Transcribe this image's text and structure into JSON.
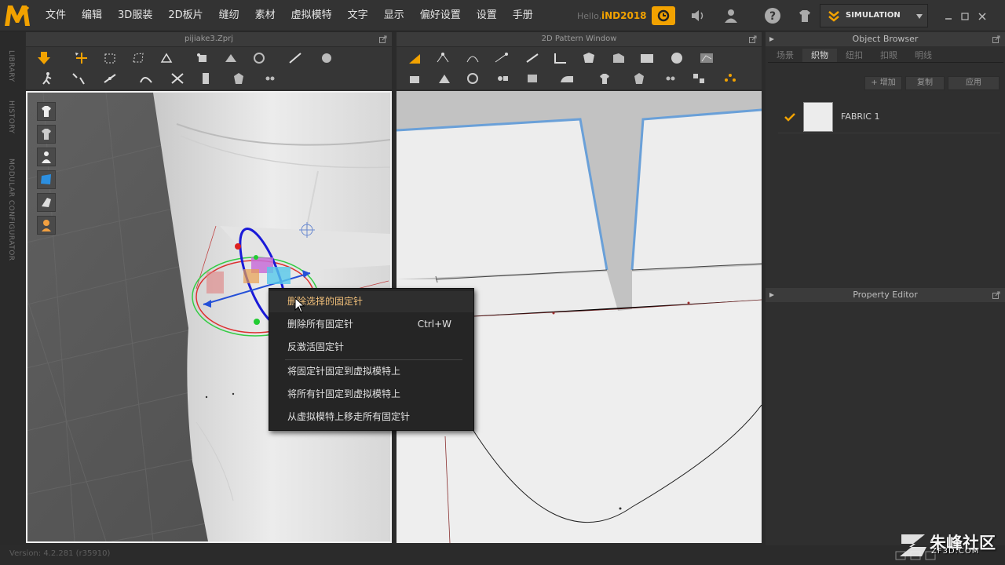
{
  "app": {
    "menu": [
      "文件",
      "编辑",
      "3D服装",
      "2D板片",
      "缝纫",
      "素材",
      "虚拟模特",
      "文字",
      "显示",
      "偏好设置",
      "设置",
      "手册"
    ],
    "hello": "Hello,",
    "user": "iND2018",
    "simulation_label": "SIMULATION",
    "accent": "#f2a200"
  },
  "sidebar_tabs": [
    "LIBRARY",
    "HISTORY",
    "MODULAR CONFIGURATOR"
  ],
  "panel_3d": {
    "title": "pijiake3.Zprj"
  },
  "panel_2d": {
    "title": "2D Pattern Window"
  },
  "object_browser": {
    "title": "Object Browser",
    "tabs": [
      "场景",
      "织物",
      "纽扣",
      "扣眼",
      "明线"
    ],
    "active_tab": "织物",
    "add_button": "+ 增加",
    "copy_button": "复制",
    "apply_button": "应用",
    "fabric_name": "FABRIC 1"
  },
  "property_editor": {
    "title": "Property Editor"
  },
  "context_menu": {
    "items": [
      {
        "label": "删除选择的固定针",
        "shortcut": ""
      },
      {
        "label": "删除所有固定针",
        "shortcut": "Ctrl+W"
      },
      {
        "label": "反激活固定针",
        "shortcut": ""
      },
      {
        "label": "将固定针固定到虚拟模特上",
        "shortcut": ""
      },
      {
        "label": "将所有针固定到虚拟模特上",
        "shortcut": ""
      },
      {
        "label": "从虚拟模特上移走所有固定针",
        "shortcut": ""
      }
    ]
  },
  "status": {
    "version": "Version: 4.2.281 (r35910)"
  },
  "watermark": {
    "text": "朱峰社区",
    "url": "ZF3D.COM"
  }
}
